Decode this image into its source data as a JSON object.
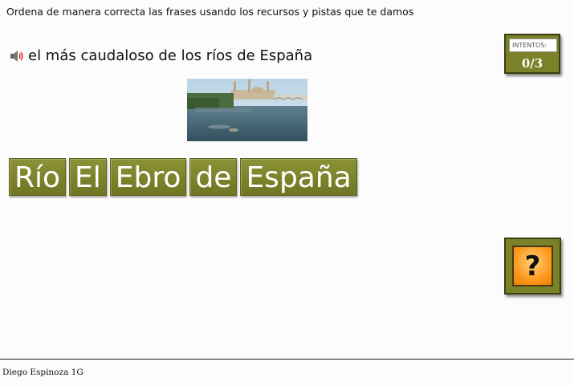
{
  "instructions": "Ordena de manera correcta las frases usando los recursos y pistas que te damos",
  "clue": {
    "icon": "speaker-icon",
    "text": "el más caudaloso de los ríos de España"
  },
  "tiles": [
    "Río",
    "El",
    "Ebro",
    "de",
    "España"
  ],
  "attempts": {
    "label": "INTENTOS:",
    "value": "0/3"
  },
  "help": {
    "icon": "question-icon",
    "label": "?"
  },
  "footer": {
    "author": "Diego Espinoza 1G"
  },
  "colors": {
    "tile_bg": "#7b8129",
    "help_orange": "#ff9a1e",
    "page_bg": "#fdfcfc"
  }
}
